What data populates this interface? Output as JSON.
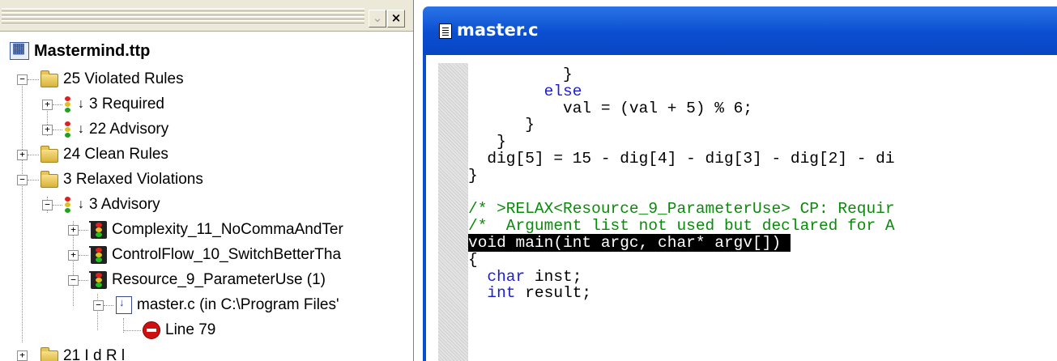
{
  "tree": {
    "project": "Mastermind.ttp",
    "violated": "25 Violated Rules",
    "required": "3 Required",
    "advisory": "22 Advisory",
    "clean": "24 Clean Rules",
    "relaxed": "3 Relaxed Violations",
    "relaxed_advisory": "3 Advisory",
    "rule1": "Complexity_11_NoCommaAndTer",
    "rule2": "ControlFlow_10_SwitchBetterTha",
    "rule3": "Resource_9_ParameterUse  (1)",
    "file": "master.c (in C:\\Program Files'",
    "line": "Line 79",
    "partial": "21 I    d R l  "
  },
  "editor": {
    "title": "master.c",
    "code": [
      {
        "text": "          }",
        "style": ""
      },
      {
        "text": "        else",
        "style": "kw"
      },
      {
        "text": "          val = (val + 5) % 6;",
        "style": ""
      },
      {
        "text": "      }",
        "style": ""
      },
      {
        "text": "   }",
        "style": ""
      },
      {
        "text": "  dig[5] = 15 - dig[4] - dig[3] - dig[2] - di",
        "style": ""
      },
      {
        "text": "}",
        "style": ""
      },
      {
        "text": "",
        "style": ""
      },
      {
        "text": "/* >RELAX<Resource_9_ParameterUse> CP: Requir",
        "style": "cm"
      },
      {
        "text": "/*  Argument list not used but declared for A",
        "style": "cm"
      },
      {
        "text": "void main(int argc, char* argv[]) ",
        "style": "hl"
      },
      {
        "text": "{",
        "style": ""
      },
      {
        "text": "  char inst;",
        "style": "mixed_char"
      },
      {
        "text": "  int result;",
        "style": "mixed_int"
      }
    ]
  }
}
